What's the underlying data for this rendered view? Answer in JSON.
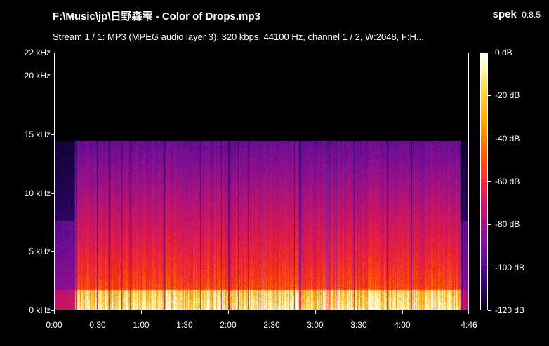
{
  "file_title": "F:\\Music\\jp\\日野森雫 - Color of Drops.mp3",
  "app": {
    "name": "spek",
    "version": "0.8.5"
  },
  "stream_info": "Stream 1 / 1: MP3 (MPEG audio layer 3), 320 kbps, 44100 Hz, channel 1 / 2, W:2048, F:H...",
  "colors": {
    "background": "#000000",
    "text": "#ffffff"
  },
  "chart_data": {
    "type": "heatmap",
    "title": "F:\\Music\\jp\\日野森雫 - Color of Drops.mp3",
    "xlabel": "",
    "ylabel": "",
    "x_ticks": [
      {
        "label": "0:00",
        "seconds": 0
      },
      {
        "label": "0:30",
        "seconds": 30
      },
      {
        "label": "1:00",
        "seconds": 60
      },
      {
        "label": "1:30",
        "seconds": 90
      },
      {
        "label": "2:00",
        "seconds": 120
      },
      {
        "label": "2:30",
        "seconds": 150
      },
      {
        "label": "3:00",
        "seconds": 180
      },
      {
        "label": "3:30",
        "seconds": 210
      },
      {
        "label": "4:00",
        "seconds": 240
      },
      {
        "label": "4:46",
        "seconds": 286
      }
    ],
    "y_ticks": [
      {
        "label": "0 kHz",
        "khz": 0
      },
      {
        "label": "5 kHz",
        "khz": 5
      },
      {
        "label": "10 kHz",
        "khz": 10
      },
      {
        "label": "15 kHz",
        "khz": 15
      },
      {
        "label": "20 kHz",
        "khz": 20
      },
      {
        "label": "22 kHz",
        "khz": 22
      }
    ],
    "colorbar_ticks": [
      {
        "label": "0 dB",
        "db": 0
      },
      {
        "label": "-20 dB",
        "db": -20
      },
      {
        "label": "-40 dB",
        "db": -40
      },
      {
        "label": "-60 dB",
        "db": -60
      },
      {
        "label": "-80 dB",
        "db": -80
      },
      {
        "label": "-100 dB",
        "db": -100
      },
      {
        "label": "-120 dB",
        "db": -120
      }
    ],
    "xlim_seconds": [
      0,
      286
    ],
    "ylim_khz": [
      0,
      22
    ],
    "zlim_db": [
      -120,
      0
    ],
    "cutoff_khz": 14.5,
    "signal_start_seconds": 14,
    "signal_end_seconds": 280
  }
}
